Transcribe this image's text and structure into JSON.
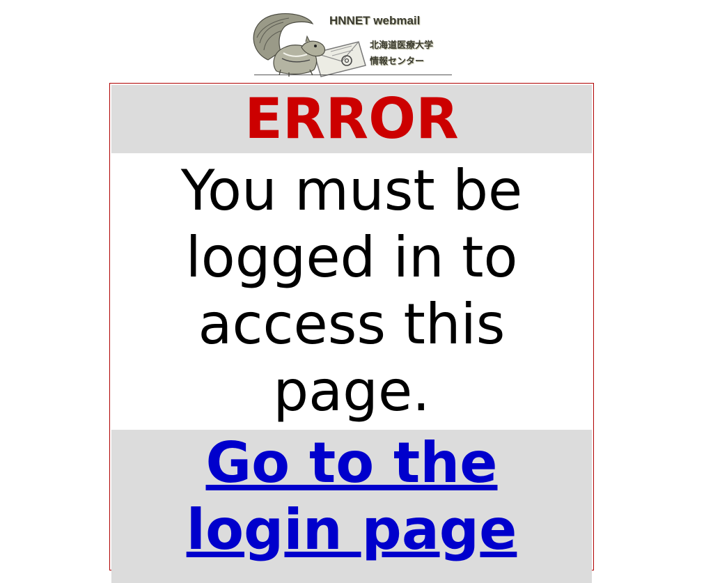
{
  "header": {
    "brand": "HNNET webmail",
    "org_line1": "北海道医療大学",
    "org_line2": "情報センター",
    "logo_icons": [
      "squirrel-icon",
      "envelope-icon",
      "at-sign-icon"
    ]
  },
  "error": {
    "title": "ERROR",
    "message": "You must be logged in to access this page.",
    "link_label": "Go to the login page"
  },
  "colors": {
    "title": "#cc0000",
    "link": "#0000cc",
    "row_bg": "#dcdcdc",
    "border": "#b00000"
  }
}
